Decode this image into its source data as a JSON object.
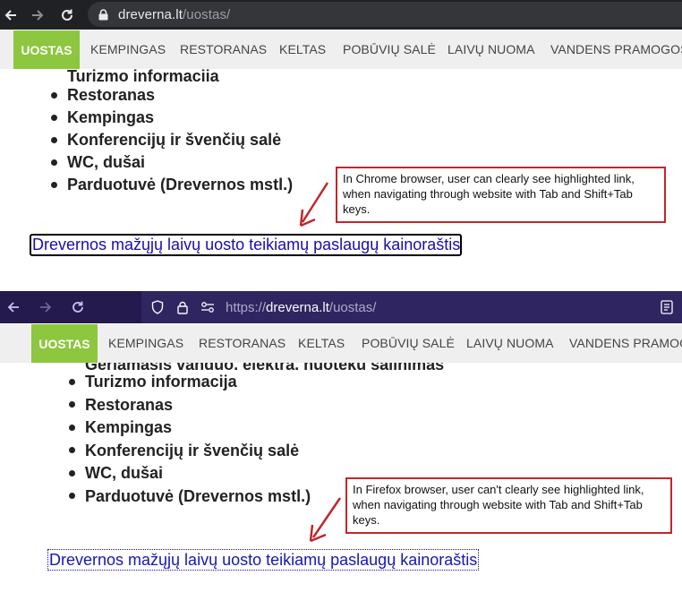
{
  "chrome": {
    "url_domain": "dreverna.lt",
    "url_path": "/uostas/"
  },
  "site_nav": {
    "active": "UOSTAS",
    "items": [
      "KEMPINGAS",
      "RESTORANAS",
      "KELTAS",
      "POBŪVIŲ SALĖ",
      "LAIVŲ NUOMA",
      "VANDENS PRAMOGOS"
    ]
  },
  "top_section": {
    "cut_item": "Turizmo informacija",
    "items": [
      "Restoranas",
      "Kempingas",
      "Konferencijų ir švenčių salė",
      "WC, dušai",
      "Parduotuvė (Drevernos mstl.)"
    ],
    "link_text": "Drevernos mažųjų laivų uosto teikiamų paslaugų kainoraštis",
    "callout": "In Chrome browser, user can clearly see highlighted link, when navigating through website with Tab and Shift+Tab keys."
  },
  "firefox": {
    "url_prefix": "https://",
    "url_domain": "dreverna.lt",
    "url_path": "/uostas/"
  },
  "site_nav_ff": {
    "active": "UOSTAS",
    "items": [
      "KEMPINGAS",
      "RESTORANAS",
      "KELTAS",
      "POBŪVIŲ SALĖ",
      "LAIVŲ NUOMA",
      "VANDENS PRAMOGOS"
    ]
  },
  "bottom_section": {
    "cut_item": "Geriamasis vanduo, elektra, nuotekų šalinimas",
    "items": [
      "Turizmo informacija",
      "Restoranas",
      "Kempingas",
      "Konferencijų ir švenčių salė",
      "WC, dušai",
      "Parduotuvė (Drevernos mstl.)"
    ],
    "link_text": "Drevernos mažųjų laivų uosto teikiamų paslaugų kainoraštis",
    "callout": "In Firefox browser, user can't clearly see highlighted link, when navigating through website with Tab and Shift+Tab keys."
  },
  "colors": {
    "accent_green": "#8dc63f",
    "callout_red": "#c0272d",
    "link_blue": "#1a0dab",
    "firefox_purple": "#2b1d5a"
  }
}
